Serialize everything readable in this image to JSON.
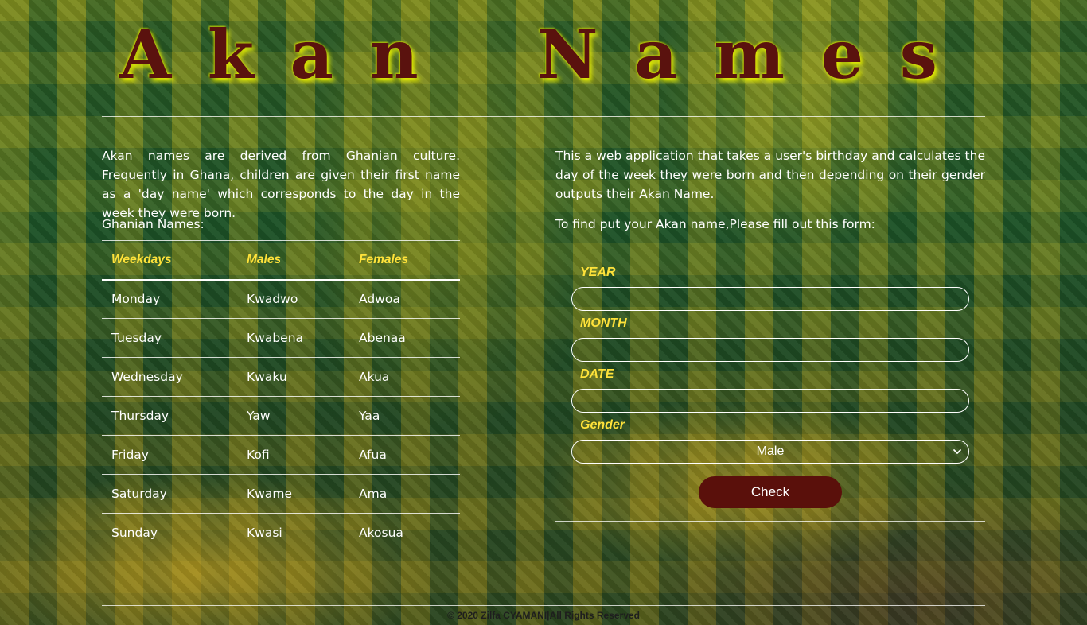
{
  "header": {
    "title_letters_1": [
      "A",
      "k",
      "a",
      "n"
    ],
    "title_letters_2": [
      "N",
      "a",
      "m",
      "e",
      "s"
    ]
  },
  "left": {
    "intro": "Akan names are derived from Ghanian culture. Frequently in Ghana, children are given their first name as a 'day name' which corresponds to the day in the week they were born.",
    "subheading": "Ghanian Names:",
    "table": {
      "headers": [
        "Weekdays",
        "Males",
        "Females"
      ],
      "rows": [
        [
          "Monday",
          "Kwadwo",
          "Adwoa"
        ],
        [
          "Tuesday",
          "Kwabena",
          "Abenaa"
        ],
        [
          "Wednesday",
          "Kwaku",
          "Akua"
        ],
        [
          "Thursday",
          "Yaw",
          "Yaa"
        ],
        [
          "Friday",
          "Kofi",
          "Afua"
        ],
        [
          "Saturday",
          "Kwame",
          "Ama"
        ],
        [
          "Sunday",
          "Kwasi",
          "Akosua"
        ]
      ]
    }
  },
  "right": {
    "intro": "This a web application that takes a user's birthday and calculates the day of the week they were born and then depending on their gender outputs their Akan Name.",
    "subheading": "To find put your Akan name,Please fill out this form:",
    "form": {
      "year_label": "YEAR",
      "year_value": "",
      "month_label": "MONTH",
      "month_value": "",
      "date_label": "DATE",
      "date_value": "",
      "gender_label": "Gender",
      "gender_selected": "Male",
      "submit_label": "Check"
    }
  },
  "footer": {
    "text": "© 2020 Zilfa CYAMANI|All Rights Reserved"
  },
  "colors": {
    "title": "#5a120e",
    "title_glow": "#e7f000",
    "label_yellow": "#ffe23a",
    "button_bg": "#5a100b"
  },
  "icons": {
    "select_chevron": "chevron-down-icon"
  }
}
